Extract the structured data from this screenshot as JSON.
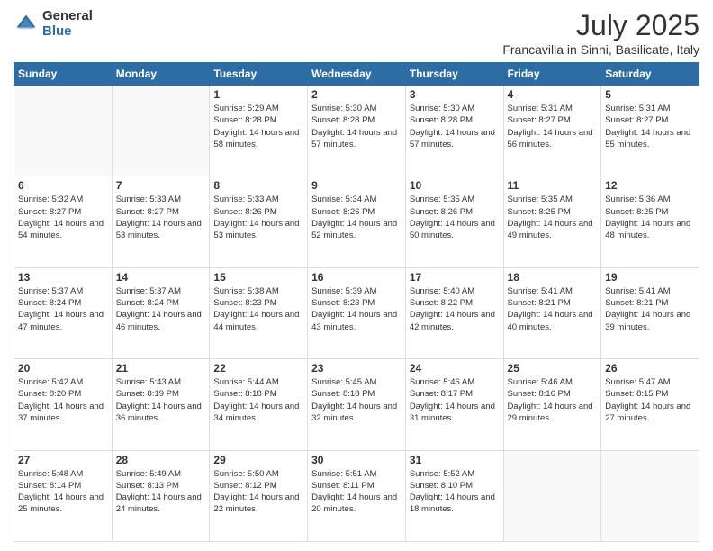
{
  "logo": {
    "general": "General",
    "blue": "Blue"
  },
  "title": "July 2025",
  "subtitle": "Francavilla in Sinni, Basilicate, Italy",
  "days_header": [
    "Sunday",
    "Monday",
    "Tuesday",
    "Wednesday",
    "Thursday",
    "Friday",
    "Saturday"
  ],
  "weeks": [
    [
      {
        "day": "",
        "sunrise": "",
        "sunset": "",
        "daylight": ""
      },
      {
        "day": "",
        "sunrise": "",
        "sunset": "",
        "daylight": ""
      },
      {
        "day": "1",
        "sunrise": "Sunrise: 5:29 AM",
        "sunset": "Sunset: 8:28 PM",
        "daylight": "Daylight: 14 hours and 58 minutes."
      },
      {
        "day": "2",
        "sunrise": "Sunrise: 5:30 AM",
        "sunset": "Sunset: 8:28 PM",
        "daylight": "Daylight: 14 hours and 57 minutes."
      },
      {
        "day": "3",
        "sunrise": "Sunrise: 5:30 AM",
        "sunset": "Sunset: 8:28 PM",
        "daylight": "Daylight: 14 hours and 57 minutes."
      },
      {
        "day": "4",
        "sunrise": "Sunrise: 5:31 AM",
        "sunset": "Sunset: 8:27 PM",
        "daylight": "Daylight: 14 hours and 56 minutes."
      },
      {
        "day": "5",
        "sunrise": "Sunrise: 5:31 AM",
        "sunset": "Sunset: 8:27 PM",
        "daylight": "Daylight: 14 hours and 55 minutes."
      }
    ],
    [
      {
        "day": "6",
        "sunrise": "Sunrise: 5:32 AM",
        "sunset": "Sunset: 8:27 PM",
        "daylight": "Daylight: 14 hours and 54 minutes."
      },
      {
        "day": "7",
        "sunrise": "Sunrise: 5:33 AM",
        "sunset": "Sunset: 8:27 PM",
        "daylight": "Daylight: 14 hours and 53 minutes."
      },
      {
        "day": "8",
        "sunrise": "Sunrise: 5:33 AM",
        "sunset": "Sunset: 8:26 PM",
        "daylight": "Daylight: 14 hours and 53 minutes."
      },
      {
        "day": "9",
        "sunrise": "Sunrise: 5:34 AM",
        "sunset": "Sunset: 8:26 PM",
        "daylight": "Daylight: 14 hours and 52 minutes."
      },
      {
        "day": "10",
        "sunrise": "Sunrise: 5:35 AM",
        "sunset": "Sunset: 8:26 PM",
        "daylight": "Daylight: 14 hours and 50 minutes."
      },
      {
        "day": "11",
        "sunrise": "Sunrise: 5:35 AM",
        "sunset": "Sunset: 8:25 PM",
        "daylight": "Daylight: 14 hours and 49 minutes."
      },
      {
        "day": "12",
        "sunrise": "Sunrise: 5:36 AM",
        "sunset": "Sunset: 8:25 PM",
        "daylight": "Daylight: 14 hours and 48 minutes."
      }
    ],
    [
      {
        "day": "13",
        "sunrise": "Sunrise: 5:37 AM",
        "sunset": "Sunset: 8:24 PM",
        "daylight": "Daylight: 14 hours and 47 minutes."
      },
      {
        "day": "14",
        "sunrise": "Sunrise: 5:37 AM",
        "sunset": "Sunset: 8:24 PM",
        "daylight": "Daylight: 14 hours and 46 minutes."
      },
      {
        "day": "15",
        "sunrise": "Sunrise: 5:38 AM",
        "sunset": "Sunset: 8:23 PM",
        "daylight": "Daylight: 14 hours and 44 minutes."
      },
      {
        "day": "16",
        "sunrise": "Sunrise: 5:39 AM",
        "sunset": "Sunset: 8:23 PM",
        "daylight": "Daylight: 14 hours and 43 minutes."
      },
      {
        "day": "17",
        "sunrise": "Sunrise: 5:40 AM",
        "sunset": "Sunset: 8:22 PM",
        "daylight": "Daylight: 14 hours and 42 minutes."
      },
      {
        "day": "18",
        "sunrise": "Sunrise: 5:41 AM",
        "sunset": "Sunset: 8:21 PM",
        "daylight": "Daylight: 14 hours and 40 minutes."
      },
      {
        "day": "19",
        "sunrise": "Sunrise: 5:41 AM",
        "sunset": "Sunset: 8:21 PM",
        "daylight": "Daylight: 14 hours and 39 minutes."
      }
    ],
    [
      {
        "day": "20",
        "sunrise": "Sunrise: 5:42 AM",
        "sunset": "Sunset: 8:20 PM",
        "daylight": "Daylight: 14 hours and 37 minutes."
      },
      {
        "day": "21",
        "sunrise": "Sunrise: 5:43 AM",
        "sunset": "Sunset: 8:19 PM",
        "daylight": "Daylight: 14 hours and 36 minutes."
      },
      {
        "day": "22",
        "sunrise": "Sunrise: 5:44 AM",
        "sunset": "Sunset: 8:18 PM",
        "daylight": "Daylight: 14 hours and 34 minutes."
      },
      {
        "day": "23",
        "sunrise": "Sunrise: 5:45 AM",
        "sunset": "Sunset: 8:18 PM",
        "daylight": "Daylight: 14 hours and 32 minutes."
      },
      {
        "day": "24",
        "sunrise": "Sunrise: 5:46 AM",
        "sunset": "Sunset: 8:17 PM",
        "daylight": "Daylight: 14 hours and 31 minutes."
      },
      {
        "day": "25",
        "sunrise": "Sunrise: 5:46 AM",
        "sunset": "Sunset: 8:16 PM",
        "daylight": "Daylight: 14 hours and 29 minutes."
      },
      {
        "day": "26",
        "sunrise": "Sunrise: 5:47 AM",
        "sunset": "Sunset: 8:15 PM",
        "daylight": "Daylight: 14 hours and 27 minutes."
      }
    ],
    [
      {
        "day": "27",
        "sunrise": "Sunrise: 5:48 AM",
        "sunset": "Sunset: 8:14 PM",
        "daylight": "Daylight: 14 hours and 25 minutes."
      },
      {
        "day": "28",
        "sunrise": "Sunrise: 5:49 AM",
        "sunset": "Sunset: 8:13 PM",
        "daylight": "Daylight: 14 hours and 24 minutes."
      },
      {
        "day": "29",
        "sunrise": "Sunrise: 5:50 AM",
        "sunset": "Sunset: 8:12 PM",
        "daylight": "Daylight: 14 hours and 22 minutes."
      },
      {
        "day": "30",
        "sunrise": "Sunrise: 5:51 AM",
        "sunset": "Sunset: 8:11 PM",
        "daylight": "Daylight: 14 hours and 20 minutes."
      },
      {
        "day": "31",
        "sunrise": "Sunrise: 5:52 AM",
        "sunset": "Sunset: 8:10 PM",
        "daylight": "Daylight: 14 hours and 18 minutes."
      },
      {
        "day": "",
        "sunrise": "",
        "sunset": "",
        "daylight": ""
      },
      {
        "day": "",
        "sunrise": "",
        "sunset": "",
        "daylight": ""
      }
    ]
  ]
}
